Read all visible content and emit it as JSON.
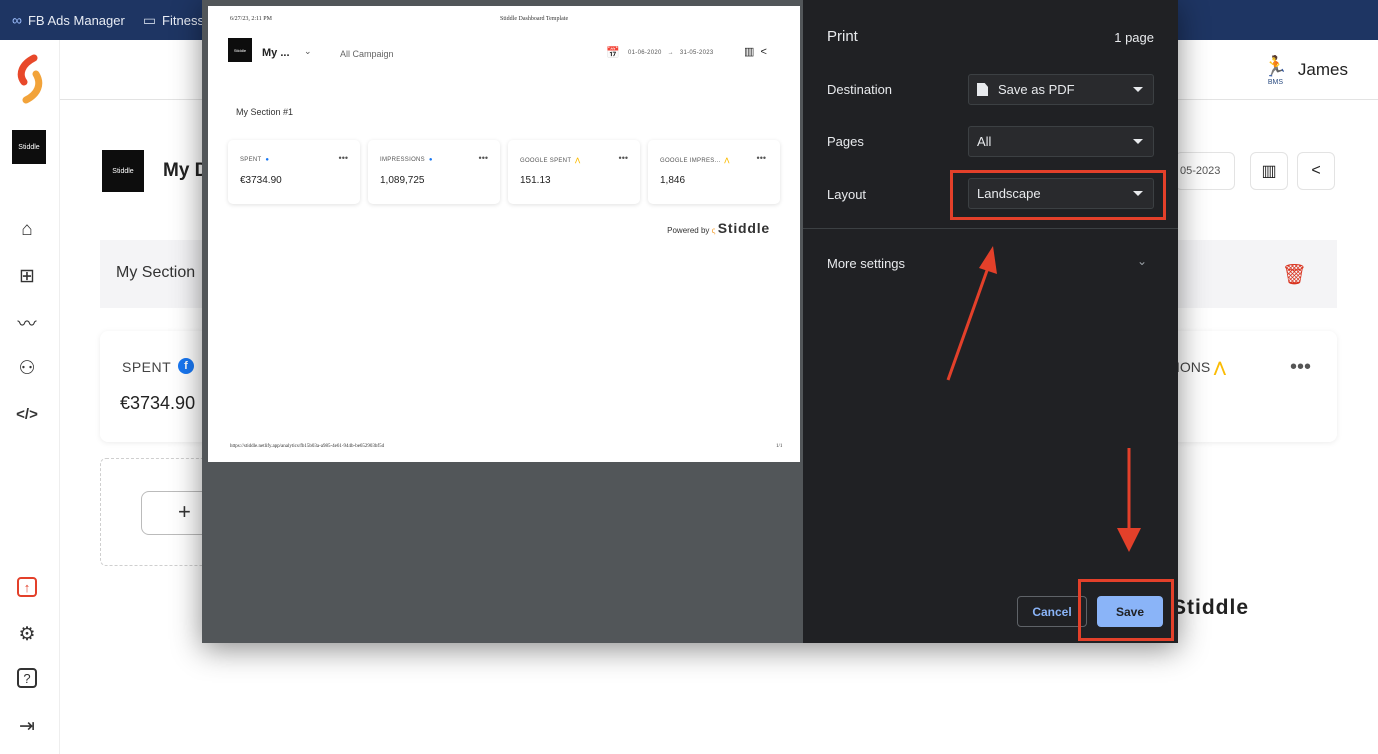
{
  "bookmarks": {
    "items": [
      {
        "icon": "meta-infinity-icon",
        "label": "FB Ads Manager"
      },
      {
        "icon": "folder-icon",
        "label": "Fitness"
      }
    ]
  },
  "user": {
    "badge": "BMS",
    "name": "James"
  },
  "brand": {
    "tile_text": "Stiddle"
  },
  "dashboard": {
    "title": "My D",
    "section_label": "My Section",
    "date_end_partial": "05-2023",
    "kpi": {
      "label": "SPENT",
      "value": "€3734.90",
      "right_label": "IONS",
      "dots": "•••"
    },
    "add_button": "+",
    "powered_partial": "Stiddle"
  },
  "print_preview": {
    "timestamp": "6/27/23, 2:11 PM",
    "doc_title": "Stiddle Dashboard Template",
    "brand_text": "Stiddle",
    "dashboard_title": "My ...",
    "campaign": "All Campaign",
    "date_start": "01-06-2020",
    "date_arrow": "→",
    "date_end": "31-05-2023",
    "section": "My Section #1",
    "cards": [
      {
        "label": "SPENT",
        "source": "facebook",
        "value": "€3734.90"
      },
      {
        "label": "IMPRESSIONS",
        "source": "facebook",
        "value": "1,089,725"
      },
      {
        "label": "GOOGLE SPENT",
        "source": "google-ads",
        "value": "151.13"
      },
      {
        "label": "GOOGLE IMPRES...",
        "source": "google-ads",
        "value": "1,846"
      }
    ],
    "powered_by": "Powered by",
    "powered_brand": "Stiddle",
    "url": "https://stiddle.netlify.app/analytics/fb15b03a-a985-4e61-944b-be652903bf5d",
    "page_number": "1/1"
  },
  "print_panel": {
    "title": "Print",
    "page_count": "1 page",
    "destination_label": "Destination",
    "destination_value": "Save as PDF",
    "pages_label": "Pages",
    "pages_value": "All",
    "layout_label": "Layout",
    "layout_value": "Landscape",
    "more_settings": "More settings",
    "cancel": "Cancel",
    "save": "Save"
  },
  "colors": {
    "bookmarks_bar": "#1e3563",
    "panel_bg": "#202124",
    "accent_blue": "#8ab4f8",
    "annotation_red": "#e3402a"
  }
}
